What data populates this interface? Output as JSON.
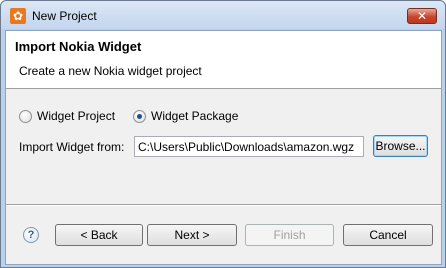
{
  "window": {
    "title": "New Project",
    "close_glyph": "✕"
  },
  "banner": {
    "title": "Import Nokia Widget",
    "description": "Create a new Nokia widget project"
  },
  "options": {
    "widget_project_label": "Widget Project",
    "widget_project_selected": false,
    "widget_package_label": "Widget Package",
    "widget_package_selected": true
  },
  "import": {
    "label": "Import Widget from:",
    "path_value": "C:\\Users\\Public\\Downloads\\amazon.wgz",
    "browse_label": "Browse..."
  },
  "footer": {
    "help_glyph": "?",
    "back_label": "< Back",
    "next_label": "Next >",
    "finish_label": "Finish",
    "cancel_label": "Cancel"
  },
  "colors": {
    "title_gradient_top": "#dbe7f5",
    "close_button": "#c9452d",
    "app_icon": "#e9781e",
    "default_button_border": "#3c7fb1"
  }
}
